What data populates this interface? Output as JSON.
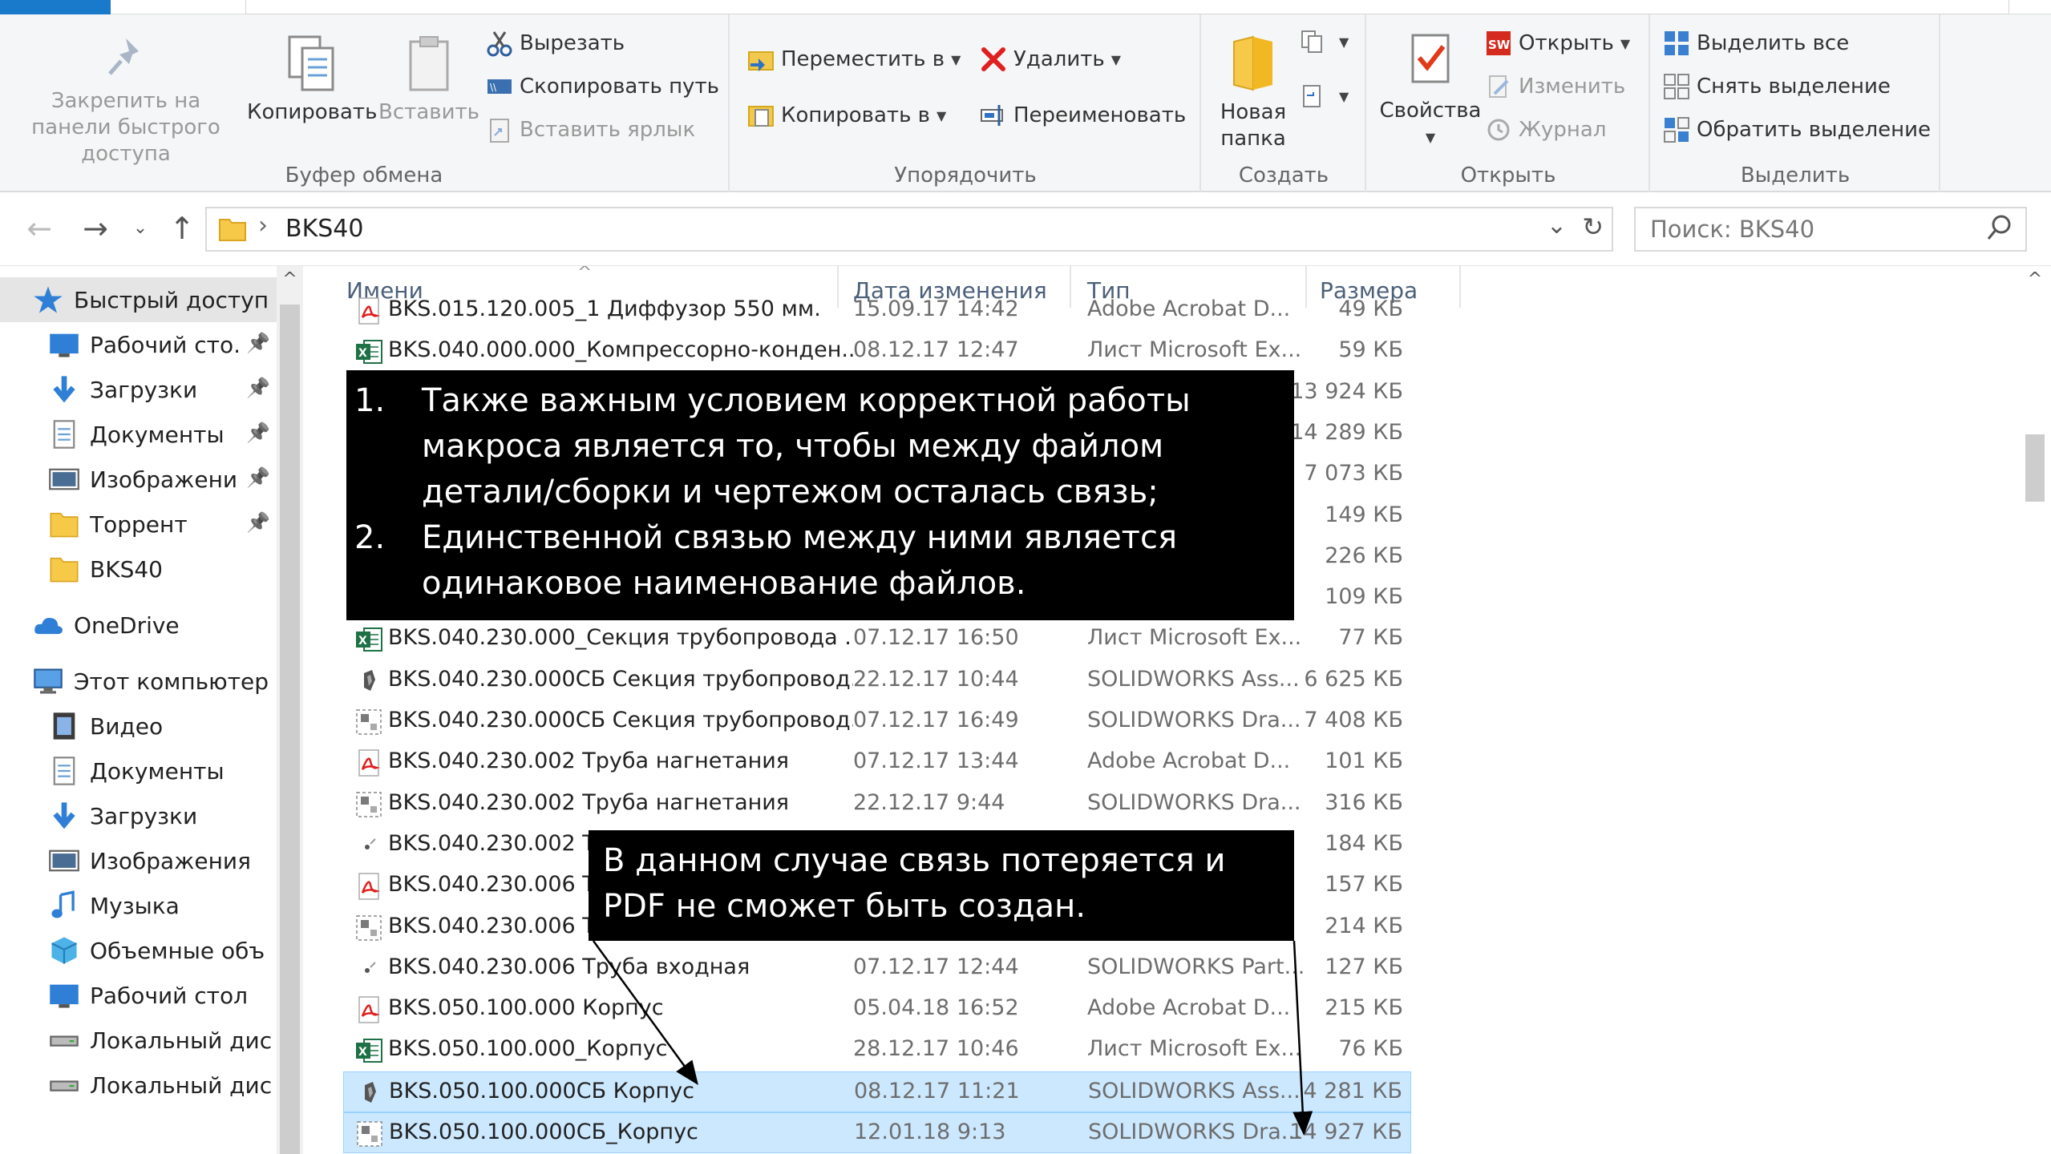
{
  "ribbon": {
    "clipboard": {
      "pin_label": "Закрепить на панели быстрого доступа",
      "copy_label": "Копировать",
      "paste_label": "Вставить",
      "cut_label": "Вырезать",
      "copy_path_label": "Скопировать путь",
      "paste_shortcut_label": "Вставить ярлык",
      "group_label": "Буфер обмена"
    },
    "organize": {
      "move_to_label": "Переместить в",
      "copy_to_label": "Копировать в",
      "delete_label": "Удалить",
      "rename_label": "Переименовать",
      "group_label": "Упорядочить"
    },
    "new": {
      "new_folder_label": "Новая папка",
      "group_label": "Создать"
    },
    "open": {
      "properties_label": "Свойства",
      "open_label": "Открыть",
      "edit_label": "Изменить",
      "history_label": "Журнал",
      "group_label": "Открыть"
    },
    "select": {
      "select_all_label": "Выделить все",
      "select_none_label": "Снять выделение",
      "invert_label": "Обратить выделение",
      "group_label": "Выделить"
    }
  },
  "address": {
    "path": "BKS40",
    "search_placeholder": "Поиск: BKS40"
  },
  "nav": {
    "items": [
      {
        "label": "Быстрый доступ",
        "icon": "star-icon"
      },
      {
        "label": "Рабочий сто.",
        "icon": "desktop-icon"
      },
      {
        "label": "Загрузки",
        "icon": "download-icon"
      },
      {
        "label": "Документы",
        "icon": "documents-icon"
      },
      {
        "label": "Изображени",
        "icon": "pictures-icon"
      },
      {
        "label": "Торрент",
        "icon": "folder-icon"
      },
      {
        "label": "BKS40",
        "icon": "folder-icon"
      },
      {
        "label": "OneDrive",
        "icon": "cloud-icon"
      },
      {
        "label": "Этот компьютер",
        "icon": "computer-icon"
      },
      {
        "label": "Видео",
        "icon": "video-icon"
      },
      {
        "label": "Документы",
        "icon": "documents-icon"
      },
      {
        "label": "Загрузки",
        "icon": "download-icon"
      },
      {
        "label": "Изображения",
        "icon": "pictures-icon"
      },
      {
        "label": "Музыка",
        "icon": "music-icon"
      },
      {
        "label": "Объемные объ",
        "icon": "3d-objects-icon"
      },
      {
        "label": "Рабочий стол",
        "icon": "desktop-icon"
      },
      {
        "label": "Локальный дис",
        "icon": "drive-icon"
      },
      {
        "label": "Локальный дис",
        "icon": "drive-icon"
      }
    ]
  },
  "columns": {
    "name": "Имени",
    "date": "Дата изменения",
    "type": "Тип",
    "size": "Размера"
  },
  "files": [
    {
      "name": "BKS.015.120.005_1 Диффузор 550 мм.",
      "date": "15.09.17 14:42",
      "type": "Adobe Acrobat D...",
      "size": "49 КБ",
      "icon": "pdf-icon"
    },
    {
      "name": "BKS.040.000.000_Компрессорно-конден...",
      "date": "08.12.17 12:47",
      "type": "Лист Microsoft Ex...",
      "size": "59 КБ",
      "icon": "excel-icon"
    },
    {
      "name": "",
      "date": "",
      "type": "",
      "size": "13 924 КБ",
      "icon": ""
    },
    {
      "name": "",
      "date": "",
      "type": "",
      "size": "14 289 КБ",
      "icon": ""
    },
    {
      "name": "",
      "date": "",
      "type": "",
      "size": "7 073 КБ",
      "icon": ""
    },
    {
      "name": "",
      "date": "",
      "type": "",
      "size": "149 КБ",
      "icon": ""
    },
    {
      "name": "",
      "date": "",
      "type": "",
      "size": "226 КБ",
      "icon": ""
    },
    {
      "name": "",
      "date": "",
      "type": "",
      "size": "109 КБ",
      "icon": ""
    },
    {
      "name": "BKS.040.230.000_Секция трубопровода ...",
      "date": "07.12.17 16:50",
      "type": "Лист Microsoft Ex...",
      "size": "77 КБ",
      "icon": "excel-icon"
    },
    {
      "name": "BKS.040.230.000СБ Секция трубопровод...",
      "date": "22.12.17 10:44",
      "type": "SOLIDWORKS Ass...",
      "size": "6 625 КБ",
      "icon": "sw-assembly-icon"
    },
    {
      "name": "BKS.040.230.000СБ Секция трубопровод...",
      "date": "07.12.17 16:49",
      "type": "SOLIDWORKS Dra...",
      "size": "7 408 КБ",
      "icon": "sw-drawing-icon"
    },
    {
      "name": "BKS.040.230.002 Труба нагнетания",
      "date": "07.12.17 13:44",
      "type": "Adobe Acrobat D...",
      "size": "101 КБ",
      "icon": "pdf-icon"
    },
    {
      "name": "BKS.040.230.002 Труба нагнетания",
      "date": "22.12.17 9:44",
      "type": "SOLIDWORKS Dra...",
      "size": "316 КБ",
      "icon": "sw-drawing-icon"
    },
    {
      "name": "BKS.040.230.002 Тру",
      "date": "",
      "type": "",
      "size": "184 КБ",
      "icon": "sw-part-icon"
    },
    {
      "name": "BKS.040.230.006 Тру",
      "date": "",
      "type": "",
      "size": "157 КБ",
      "icon": "pdf-icon"
    },
    {
      "name": "BKS.040.230.006 Тру",
      "date": "",
      "type": "",
      "size": "214 КБ",
      "icon": "sw-drawing-icon"
    },
    {
      "name": "BKS.040.230.006 Труба входная",
      "date": "07.12.17 12:44",
      "type": "SOLIDWORKS Part...",
      "size": "127 КБ",
      "icon": "sw-part-icon"
    },
    {
      "name": "BKS.050.100.000 Корпус",
      "date": "05.04.18 16:52",
      "type": "Adobe Acrobat D...",
      "size": "215 КБ",
      "icon": "pdf-icon"
    },
    {
      "name": "BKS.050.100.000_Корпус",
      "date": "28.12.17 10:46",
      "type": "Лист Microsoft Ex...",
      "size": "76 КБ",
      "icon": "excel-icon"
    },
    {
      "name": "BKS.050.100.000СБ Корпус",
      "date": "08.12.17 11:21",
      "type": "SOLIDWORKS Ass...",
      "size": "4 281 КБ",
      "icon": "sw-assembly-icon",
      "highlighted": true
    },
    {
      "name": "BKS.050.100.000СБ_Корпус",
      "date": "12.01.18 9:13",
      "type": "SOLIDWORKS Dra...",
      "size": "14 927 КБ",
      "icon": "sw-drawing-icon",
      "highlighted": true
    }
  ],
  "callouts": {
    "main": {
      "item1_num": "1.",
      "item1_text": "Также важным условием корректной работы макроса является то, чтобы между файлом детали/сборки и чертежом осталась связь;",
      "item2_num": "2.",
      "item2_text": "Единственной связью между ними является одинаковое наименование файлов."
    },
    "note": "В данном случае связь потеряется и PDF не сможет быть создан."
  },
  "colors": {
    "accent": "#1979ca",
    "selection": "#cce8ff",
    "callout_bg": "#000000",
    "callout_text": "#ffffff"
  }
}
